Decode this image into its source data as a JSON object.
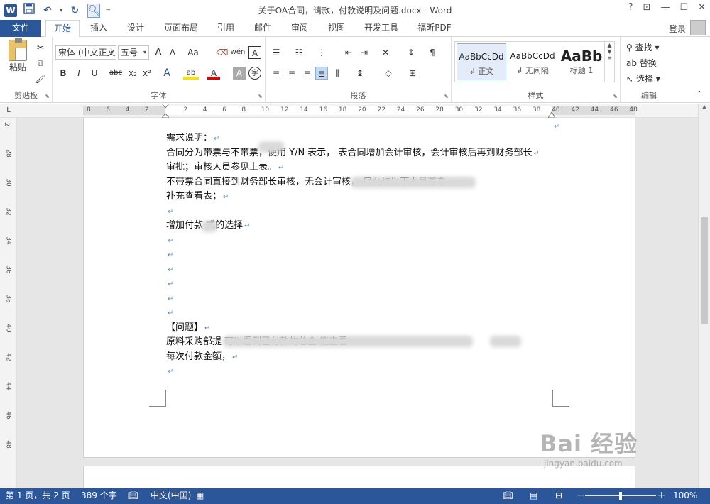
{
  "titlebar": {
    "app_icon": "W",
    "title": "关于OA合同，请款，付款说明及问题.docx - Word",
    "help": "?",
    "ribbon_options": "⊡",
    "minimize": "—",
    "restore": "☐",
    "close": "✕"
  },
  "tabs": {
    "file": "文件",
    "home": "开始",
    "insert": "插入",
    "design": "设计",
    "layout": "页面布局",
    "references": "引用",
    "mailings": "邮件",
    "review": "审阅",
    "view": "视图",
    "developer": "开发工具",
    "foxit": "福昕PDF",
    "login": "登录"
  },
  "ribbon": {
    "clipboard": {
      "paste": "粘贴",
      "label": "剪贴板"
    },
    "font": {
      "font_name": "宋体 (中文正文",
      "font_size": "五号",
      "grow": "A",
      "shrink": "A",
      "case": "Aa",
      "pinyin": "wén",
      "border": "A",
      "bold": "B",
      "italic": "I",
      "underline": "U",
      "strike": "abc",
      "sub": "x₂",
      "sup": "x²",
      "effects": "A",
      "highlight": "ab",
      "color": "A",
      "shade": "A",
      "circle": "字",
      "label": "字体"
    },
    "paragraph": {
      "label": "段落"
    },
    "styles": {
      "label": "样式",
      "items": [
        {
          "sample": "AaBbCcDd",
          "name": "↲ 正文"
        },
        {
          "sample": "AaBbCcDd",
          "name": "↲ 无间隔"
        },
        {
          "sample": "AaBb",
          "name": "标题 1"
        }
      ]
    },
    "editing": {
      "find": "查找",
      "replace": "替换",
      "select": "选择",
      "label": "编辑"
    }
  },
  "ruler": {
    "corner": "L",
    "ticks": [
      "8",
      "6",
      "4",
      "2",
      "",
      "2",
      "4",
      "6",
      "8",
      "10",
      "12",
      "14",
      "16",
      "18",
      "20",
      "22",
      "24",
      "26",
      "28",
      "30",
      "32",
      "34",
      "36",
      "38",
      "40",
      "42",
      "44",
      "46",
      "48"
    ],
    "vticks": [
      "2",
      "28",
      "30",
      "32",
      "34",
      "36",
      "38",
      "40",
      "42",
      "44",
      "46",
      "48"
    ]
  },
  "document": {
    "lines": [
      "需求说明：",
      "合同分为带票与不带票，使用 Y/N 表示，      表合同增加会计审核，会计审核后再到财务部长",
      "审批；审核人员参见上表。",
      "不带票合同直接到财务部长审核，无会计审核，                       只允许以下人员查看",
      "补充查看表；",
      "",
      "增加付款   式的选择",
      "",
      "",
      "",
      "",
      "",
      "",
      "【问题】",
      "原料采购部提                                        可以看到已付款的总金       能查看",
      "每次付款金额，",
      ""
    ],
    "para_mark": "↵"
  },
  "statusbar": {
    "page": "第 1 页，共 2 页",
    "words": "389 个字",
    "lang": "中文(中国)",
    "zoom_minus": "−",
    "zoom_plus": "+",
    "zoom": "100%",
    "zoom_level": 0.5
  },
  "watermark": {
    "brand": "Bai 经验",
    "url": "jingyan.baidu.com"
  }
}
